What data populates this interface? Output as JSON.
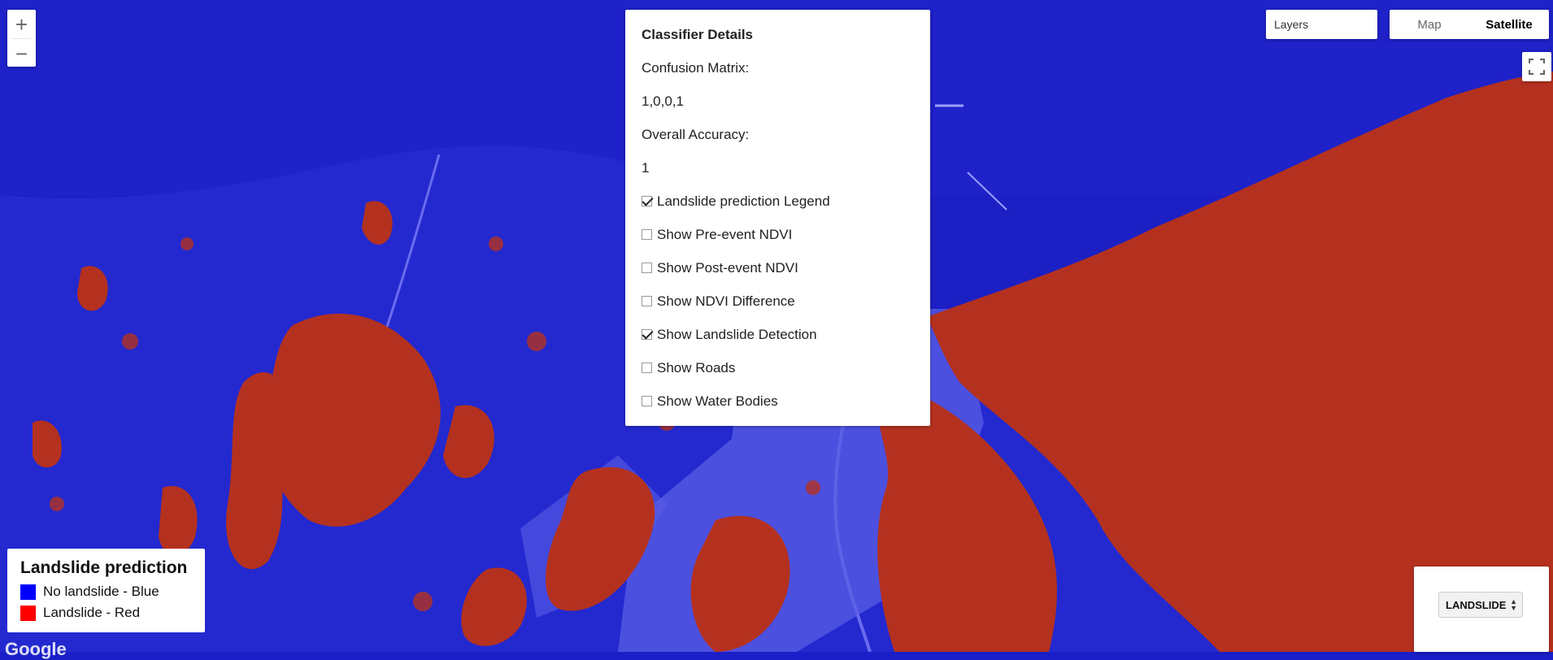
{
  "zoom": {
    "in_label": "+",
    "out_label": "−"
  },
  "panel": {
    "title": "Classifier Details",
    "confusion_label": "Confusion Matrix:",
    "confusion_value": "1,0,0,1",
    "accuracy_label": "Overall Accuracy:",
    "accuracy_value": "1",
    "checkboxes": [
      {
        "label": "Landslide prediction Legend",
        "checked": true
      },
      {
        "label": "Show Pre-event NDVI",
        "checked": false
      },
      {
        "label": "Show Post-event NDVI",
        "checked": false
      },
      {
        "label": "Show NDVI Difference",
        "checked": false
      },
      {
        "label": "Show Landslide Detection",
        "checked": true
      },
      {
        "label": "Show Roads",
        "checked": false
      },
      {
        "label": "Show Water Bodies",
        "checked": false
      }
    ]
  },
  "layers": {
    "label": "Layers"
  },
  "maptype": {
    "map_label": "Map",
    "satellite_label": "Satellite",
    "active": "Satellite"
  },
  "legend": {
    "title": "Landslide prediction",
    "items": [
      {
        "label": "No landslide - Blue",
        "color": "#0000ff"
      },
      {
        "label": "Landslide - Red",
        "color": "#ff0000"
      }
    ]
  },
  "layer_select": {
    "value": "LANDSLIDE"
  },
  "attribution": {
    "logo_text": "Google"
  },
  "colors": {
    "water": "#1a1fc8",
    "land_blue": "#2a2fd0",
    "landslide_red": "#b8321f",
    "urban": "#5a5de0"
  }
}
